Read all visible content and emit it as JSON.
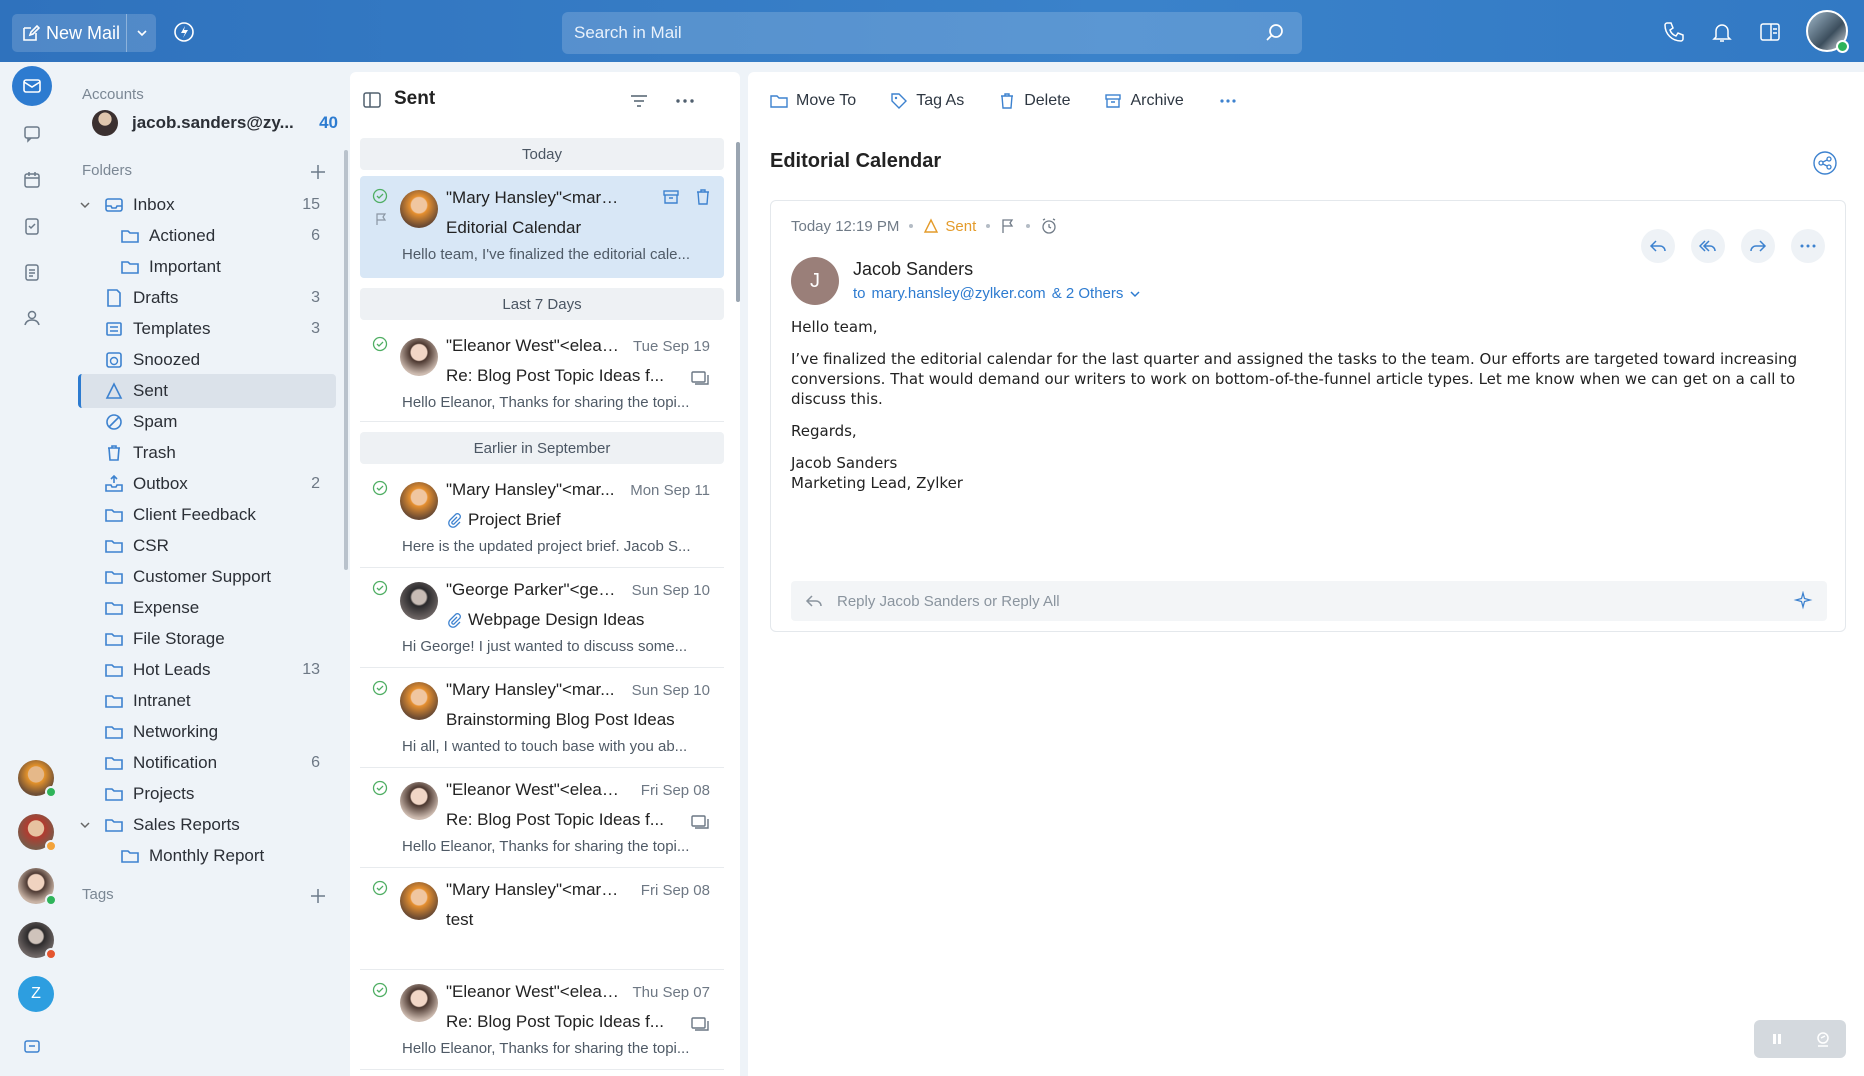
{
  "topbar": {
    "new_mail_label": "New Mail",
    "search_placeholder": "Search in Mail"
  },
  "accounts": {
    "header": "Accounts",
    "email": "jacob.sanders@zy...",
    "count": "40"
  },
  "folders": {
    "header": "Folders",
    "items": [
      {
        "name": "Inbox",
        "count": "15"
      },
      {
        "name": "Actioned",
        "count": "6"
      },
      {
        "name": "Important",
        "count": ""
      },
      {
        "name": "Drafts",
        "count": "3"
      },
      {
        "name": "Templates",
        "count": "3"
      },
      {
        "name": "Snoozed",
        "count": ""
      },
      {
        "name": "Sent",
        "count": ""
      },
      {
        "name": "Spam",
        "count": ""
      },
      {
        "name": "Trash",
        "count": ""
      },
      {
        "name": "Outbox",
        "count": "2"
      },
      {
        "name": "Client Feedback",
        "count": ""
      },
      {
        "name": "CSR",
        "count": ""
      },
      {
        "name": "Customer Support",
        "count": ""
      },
      {
        "name": "Expense",
        "count": ""
      },
      {
        "name": "File Storage",
        "count": ""
      },
      {
        "name": "Hot Leads",
        "count": "13"
      },
      {
        "name": "Intranet",
        "count": ""
      },
      {
        "name": "Networking",
        "count": ""
      },
      {
        "name": "Notification",
        "count": "6"
      },
      {
        "name": "Projects",
        "count": ""
      },
      {
        "name": "Sales Reports",
        "count": ""
      },
      {
        "name": "Monthly Report",
        "count": ""
      }
    ],
    "tags_header": "Tags"
  },
  "rail": {
    "bottom_avatar_letter": "Z"
  },
  "list": {
    "title": "Sent",
    "groups": [
      "Today",
      "Last 7 Days",
      "Earlier in  September"
    ],
    "messages": [
      {
        "from": "\"Mary Hansley\"<mary....",
        "date": "",
        "subject": "Editorial Calendar",
        "preview": "Hello team, I've finalized the editorial cale..."
      },
      {
        "from": "\"Eleanor West\"<elean...",
        "date": "Tue Sep 19",
        "subject": "Re: Blog Post Topic Ideas f...",
        "preview": "Hello Eleanor, Thanks for sharing the topi..."
      },
      {
        "from": "\"Mary Hansley\"<mar...",
        "date": "Mon Sep 11",
        "subject": "Project Brief",
        "preview": "Here is the updated project brief. Jacob S..."
      },
      {
        "from": "\"George Parker\"<geo...",
        "date": "Sun Sep 10",
        "subject": "Webpage Design Ideas",
        "preview": "Hi George! I just wanted to discuss some..."
      },
      {
        "from": "\"Mary Hansley\"<mar...",
        "date": "Sun Sep 10",
        "subject": "Brainstorming Blog Post Ideas",
        "preview": "Hi all, I wanted to touch base with you ab..."
      },
      {
        "from": "\"Eleanor West\"<elean...",
        "date": "Fri Sep 08",
        "subject": "Re: Blog Post Topic Ideas f...",
        "preview": "Hello Eleanor, Thanks for sharing the topi..."
      },
      {
        "from": "\"Mary Hansley\"<mary....",
        "date": "Fri Sep 08",
        "subject": "test",
        "preview": ""
      },
      {
        "from": "\"Eleanor West\"<elean...",
        "date": "Thu Sep 07",
        "subject": "Re: Blog Post Topic Ideas f...",
        "preview": "Hello Eleanor, Thanks for sharing the topi..."
      }
    ]
  },
  "reader": {
    "toolbar": {
      "move_to": "Move To",
      "tag_as": "Tag As",
      "delete": "Delete",
      "archive": "Archive"
    },
    "subject": "Editorial Calendar",
    "meta": {
      "time": "Today 12:19 PM",
      "status": "Sent"
    },
    "sender": {
      "initial": "J",
      "name": "Jacob Sanders",
      "to_prefix": "to",
      "to_address": "mary.hansley@zylker.com",
      "others": "& 2 Others"
    },
    "body": {
      "greeting": "Hello team,",
      "paragraph": "I’ve finalized the editorial calendar for the last quarter and assigned the tasks to the team. Our efforts are targeted toward increasing conversions. That would demand our writers to work on bottom-of-the-funnel article types. Let me know when we can get on a call to discuss this.",
      "closing": "Regards,",
      "signature_name": "Jacob Sanders",
      "signature_title": "Marketing Lead, Zylker"
    },
    "reply_placeholder": "Reply Jacob Sanders or Reply All"
  },
  "colors": {
    "accent": "#2d7bd0",
    "topbar": "#3a7cc4",
    "sent_status": "#e49b2a",
    "check_green": "#4fae63"
  }
}
